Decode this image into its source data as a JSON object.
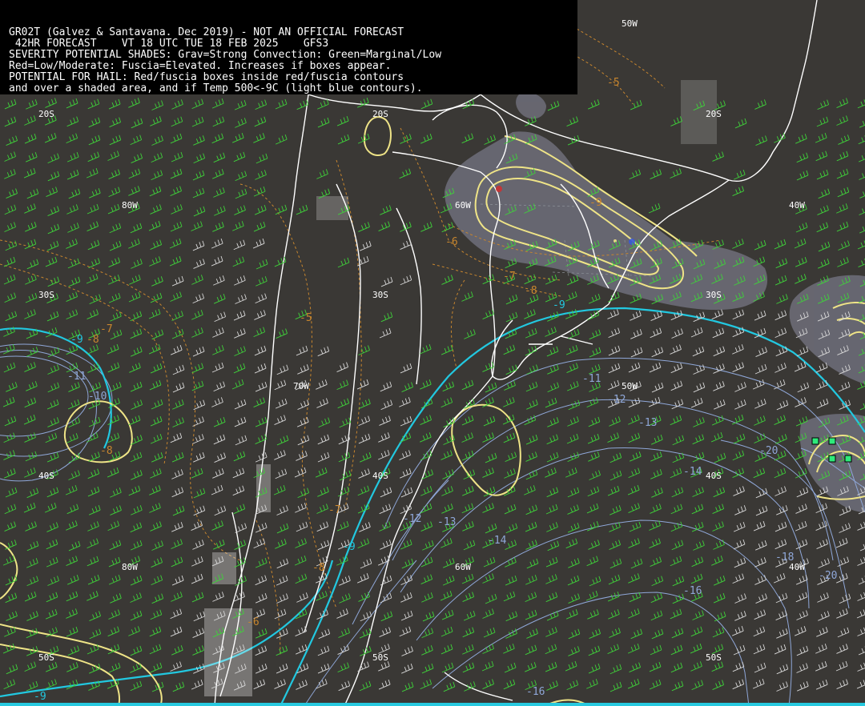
{
  "header": {
    "line1": "GR02T (Galvez & Santavana. Dec 2019) - NOT AN OFFICIAL FORECAST",
    "line2": " 42HR FORECAST    VT 18 UTC TUE 18 FEB 2025    GFS3",
    "line3": "SEVERITY POTENTIAL SHADES: Grav=Strong Convection: Green=Marginal/Low",
    "line4": "Red=Low/Moderate: Fuscia=Elevated. Increases if boxes appear.",
    "line5": "POTENTIAL FOR HAIL: Red/fuscia boxes inside red/fuscia contours",
    "line6": "and over a shaded area, and if Temp 500<-9C (light blue contours)."
  },
  "grid_labels": {
    "lat20_w": "20S",
    "lat20_m": "20S",
    "lat20_e": "20S",
    "lat30_w": "30S",
    "lat30_m": "30S",
    "lat30_e": "30S",
    "lat40_w": "40S",
    "lat40_m": "40S",
    "lat40_e": "40S",
    "lat50_m": "50S",
    "lat50_e": "50S",
    "lat50_w": "50S",
    "lon80_a": "80W",
    "lon80_b": "80W",
    "lon70": "70W",
    "lon60_a": "60W",
    "lon60_b": "60W",
    "lon50_a": "50W",
    "lon50_b": "50W",
    "lon40_a": "40W",
    "lon40_b": "40W"
  },
  "contour_labels": {
    "o_m5_a": "-5",
    "o_m5_b": "-5",
    "o_m6": "-6",
    "o_m7_a": "-7",
    "o_m7_b": "-7",
    "o_m7_c": "-7",
    "o_m8_a": "-8",
    "o_m8_b": "-8",
    "o_m8_c": "-8",
    "o_m8_d": "-8",
    "o_m9": "-9",
    "o_m6_b": "-6",
    "c_m9_a": "-9",
    "c_m9_b": "-9",
    "c_m9_c": "-9",
    "c_m9_d": "-9",
    "b_m11_a": "-11",
    "b_m11_b": "-11",
    "b_m10": "-10",
    "b_m12_a": "-12",
    "b_m12_b": "-12",
    "b_m13_a": "-13",
    "b_m13_b": "-13",
    "b_m14_a": "-14",
    "b_m14_b": "-14",
    "b_m16_a": "-16",
    "b_m16_b": "-16",
    "b_m18": "-18",
    "b_m20_a": "-20",
    "b_m20_b": "-20"
  },
  "colors": {
    "background": "#3a3835",
    "coastline": "#ffffff",
    "temp_contour": "#8fa7d8",
    "temp_minus9_contour": "#22c8e0",
    "orange_contour": "#c8862e",
    "severity_contour": "#efe487",
    "severity_shade": "#6f6f7a",
    "wind_barb_green": "#3fd23a",
    "wind_barb_white": "#d8d8d8"
  }
}
